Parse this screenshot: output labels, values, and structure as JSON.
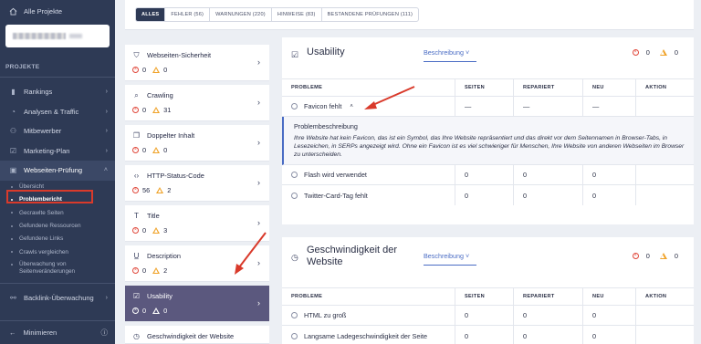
{
  "sidebar": {
    "all_projects": "Alle Projekte",
    "section_label": "PROJEKTE",
    "items": [
      {
        "label": "Rankings",
        "icon": "bar-chart-icon"
      },
      {
        "label": "Analysen & Traffic",
        "icon": "pie-chart-icon"
      },
      {
        "label": "Mitbewerber",
        "icon": "users-icon"
      },
      {
        "label": "Marketing-Plan",
        "icon": "checklist-icon"
      },
      {
        "label": "Webseiten-Prüfung",
        "icon": "audit-icon"
      }
    ],
    "subitems": [
      "Übersicht",
      "Problembericht",
      "Gecrawlte Seiten",
      "Gefundene Ressourcen",
      "Gefundene Links",
      "Crawls vergleichen"
    ],
    "subitem_multiline": "Überwachung von Seitenveränderungen",
    "backlink": "Backlink-Überwachung",
    "minimize": "Minimieren"
  },
  "filters": [
    "ALLES",
    "FEHLER (56)",
    "WARNUNGEN (220)",
    "HINWEISE (83)",
    "BESTANDENE PRÜFUNGEN (111)"
  ],
  "categories": [
    {
      "label": "Webseiten-Sicherheit",
      "icon": "shield-icon",
      "errors": "0",
      "warnings": "0"
    },
    {
      "label": "Crawling",
      "icon": "search-icon",
      "errors": "0",
      "warnings": "31"
    },
    {
      "label": "Doppelter Inhalt",
      "icon": "copy-icon",
      "errors": "0",
      "warnings": "0"
    },
    {
      "label": "HTTP-Status-Code",
      "icon": "code-icon",
      "errors": "56",
      "warnings": "2"
    },
    {
      "label": "Title",
      "icon": "title-icon",
      "errors": "0",
      "warnings": "3"
    },
    {
      "label": "Description",
      "icon": "underline-icon",
      "errors": "0",
      "warnings": "2"
    },
    {
      "label": "Usability",
      "icon": "checkbox-icon",
      "errors": "0",
      "warnings": "0"
    },
    {
      "label": "Geschwindigkeit der Website",
      "icon": "speed-icon",
      "errors": "0",
      "warnings": "0"
    }
  ],
  "usability": {
    "title": "Usability",
    "desc_link": "Beschreibung",
    "errors": "0",
    "warnings": "0",
    "columns": [
      "PROBLEME",
      "SEITEN",
      "REPARIERT",
      "NEU",
      "AKTION"
    ],
    "expanded_row": {
      "label": "Favicon fehlt",
      "pages": "—",
      "fixed": "—",
      "new": "—"
    },
    "desc_heading": "Problembeschreibung",
    "desc_text": "Ihre Website hat kein Favicon, das ist ein Symbol, das Ihre Website repräsentiert und das direkt vor dem Seitennamen in Browser-Tabs, in Lesezeichen, in SERPs angezeigt wird. Ohne ein Favicon ist es viel schwieriger für Menschen, Ihre Website von anderen Webseiten im Browser zu unterscheiden.",
    "rows": [
      {
        "label": "Flash wird verwendet",
        "pages": "0",
        "fixed": "0",
        "new": "0"
      },
      {
        "label": "Twitter-Card-Tag fehlt",
        "pages": "0",
        "fixed": "0",
        "new": "0"
      }
    ]
  },
  "speed": {
    "title": "Geschwindigkeit der Website",
    "desc_link": "Beschreibung",
    "errors": "0",
    "warnings": "0",
    "columns": [
      "PROBLEME",
      "SEITEN",
      "REPARIERT",
      "NEU",
      "AKTION"
    ],
    "rows": [
      {
        "label": "HTML zu groß",
        "pages": "0",
        "fixed": "0",
        "new": "0"
      },
      {
        "label": "Langsame Ladegeschwindigkeit der Seite",
        "pages": "0",
        "fixed": "0",
        "new": "0"
      }
    ]
  },
  "colors": {
    "sidebar_bg": "#2e3a55",
    "active_category": "#5b587e",
    "link": "#4a6cc4",
    "error": "#e0483b",
    "warning": "#f0a32a",
    "annotation": "#d93a2b"
  }
}
